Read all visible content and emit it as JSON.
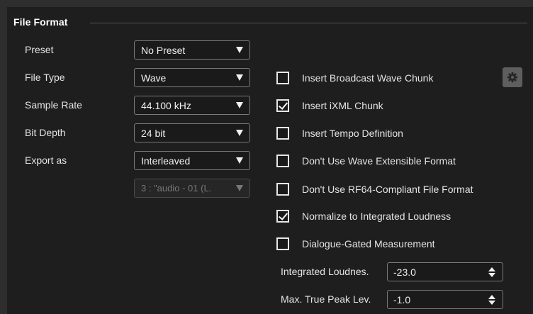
{
  "section": {
    "title": "File Format"
  },
  "fields": [
    {
      "label": "Preset",
      "value": "No Preset"
    },
    {
      "label": "File Type",
      "value": "Wave"
    },
    {
      "label": "Sample Rate",
      "value": "44.100 kHz"
    },
    {
      "label": "Bit Depth",
      "value": "24 bit"
    },
    {
      "label": "Export as",
      "value": "Interleaved"
    }
  ],
  "channel_dropdown": {
    "value": "3 : \"audio - 01 (L.",
    "enabled": false
  },
  "options": [
    {
      "label": "Insert Broadcast Wave Chunk",
      "checked": false
    },
    {
      "label": "Insert iXML Chunk",
      "checked": true
    },
    {
      "label": "Insert Tempo Definition",
      "checked": false
    },
    {
      "label": "Don't Use Wave Extensible Format",
      "checked": false
    },
    {
      "label": "Don't Use RF64-Compliant File Format",
      "checked": false
    },
    {
      "label": "Normalize to Integrated Loudness",
      "checked": true
    },
    {
      "label": "Dialogue-Gated Measurement",
      "checked": false
    }
  ],
  "settings_button": {
    "icon": "gear-icon"
  },
  "loudness": {
    "integrated": {
      "label": "Integrated Loudnes.",
      "value": "-23.0"
    },
    "true_peak": {
      "label": "Max. True Peak Lev.",
      "value": "-1.0"
    }
  }
}
